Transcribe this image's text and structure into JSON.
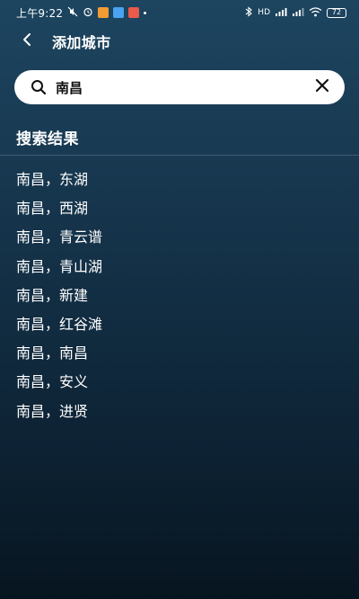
{
  "status_bar": {
    "time": "上午9:22",
    "signal_text": "HD",
    "battery": "72"
  },
  "header": {
    "title": "添加城市"
  },
  "search": {
    "value": "南昌"
  },
  "section": {
    "title": "搜索结果"
  },
  "results": [
    "南昌，东湖",
    "南昌，西湖",
    "南昌，青云谱",
    "南昌，青山湖",
    "南昌，新建",
    "南昌，红谷滩",
    "南昌，南昌",
    "南昌，安义",
    "南昌，进贤"
  ],
  "colors": {
    "background_top": "#1d4560",
    "background_bottom": "#071520",
    "search_bg": "#ffffff",
    "text": "#ffffff"
  },
  "icons": {
    "back": "back-arrow-icon",
    "search": "search-icon",
    "clear": "close-icon"
  }
}
